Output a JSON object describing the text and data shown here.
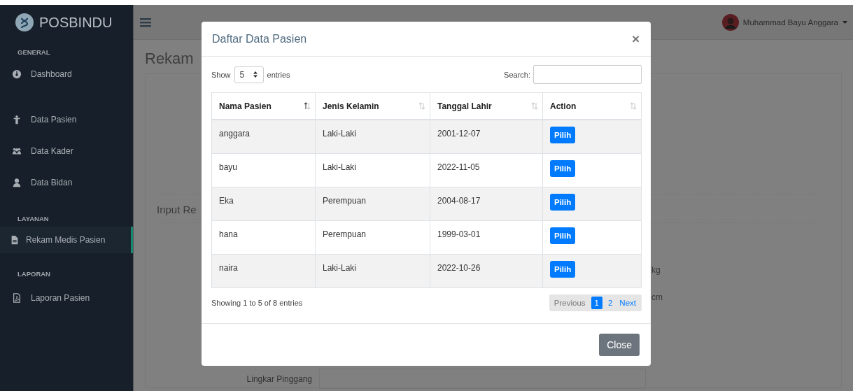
{
  "sidebar": {
    "brand": "POSBINDU",
    "sections": [
      {
        "heading": "GENERAL",
        "items": [
          {
            "label": "Dashboard",
            "kind": "dashboard",
            "selected": false
          },
          {
            "label": "Data Pasien",
            "kind": "person",
            "selected": false
          },
          {
            "label": "Data Kader",
            "kind": "users",
            "selected": false
          },
          {
            "label": "Data Bidan",
            "kind": "user",
            "selected": false
          }
        ]
      },
      {
        "heading": "LAYANAN",
        "items": [
          {
            "label": "Rekam Medis Pasien",
            "kind": "file",
            "selected": true
          }
        ]
      },
      {
        "heading": "LAPORAN",
        "items": [
          {
            "label": "Laporan Pasien",
            "kind": "pdf",
            "selected": false
          }
        ]
      }
    ]
  },
  "topbar": {
    "user_name": "Muhammad Bayu Anggara"
  },
  "page": {
    "title": "Rekam",
    "section_title": "Input Re",
    "fields": [
      {
        "unit": "kg"
      },
      {
        "unit": "cm"
      },
      {
        "label": "Lingkar Pinggang"
      }
    ]
  },
  "modal": {
    "title": "Daftar Data Pasien",
    "close": "×",
    "length": {
      "prefix": "Show",
      "value": "5",
      "suffix": "entries"
    },
    "search": {
      "label": "Search:"
    },
    "columns": [
      {
        "label": "Nama Pasien",
        "sorted": true
      },
      {
        "label": "Jenis Kelamin",
        "sorted": false
      },
      {
        "label": "Tanggal Lahir",
        "sorted": false
      },
      {
        "label": "Action",
        "sorted": false
      }
    ],
    "rows": [
      {
        "cells": [
          "anggara",
          "Laki-Laki",
          "2001-12-07"
        ],
        "action": "Pilih"
      },
      {
        "cells": [
          "bayu",
          "Laki-Laki",
          "2022-11-05"
        ],
        "action": "Pilih"
      },
      {
        "cells": [
          "Eka",
          "Perempuan",
          "2004-08-17"
        ],
        "action": "Pilih"
      },
      {
        "cells": [
          "hana",
          "Perempuan",
          "1999-03-01"
        ],
        "action": "Pilih"
      },
      {
        "cells": [
          "naira",
          "Laki-Laki",
          "2022-10-26"
        ],
        "action": "Pilih"
      }
    ],
    "info": "Showing 1 to 5 of 8 entries",
    "pagination": [
      {
        "label": "Previous",
        "disabled": true,
        "selected": false
      },
      {
        "label": "1",
        "disabled": false,
        "selected": true
      },
      {
        "label": "2",
        "disabled": false,
        "selected": false
      },
      {
        "label": "Next",
        "disabled": false,
        "selected": false
      }
    ],
    "footer_button": "Close"
  }
}
